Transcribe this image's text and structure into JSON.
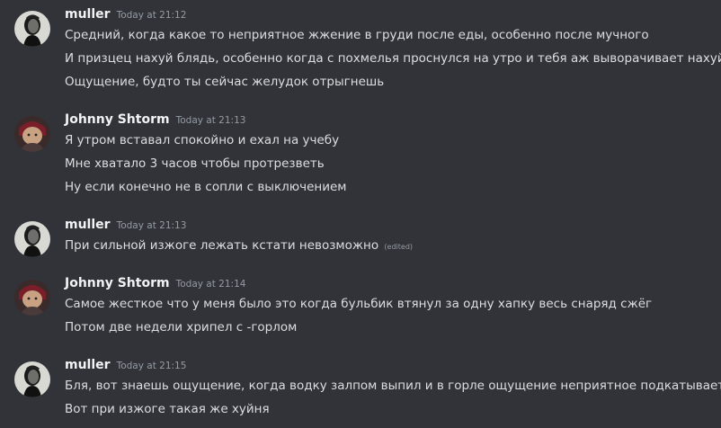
{
  "colors": {
    "background": "#313338",
    "username": "#f2f3f5",
    "message_text": "#dbdee1",
    "timestamp": "#949ba4"
  },
  "messages": [
    {
      "author": "muller",
      "timestamp": "Today at 21:12",
      "avatar_icon": "statue-avatar",
      "lines": [
        "Средний, когда какое то неприятное жжение в груди после еды, особенно после мучного",
        "И призцец нахуй блядь, особенно когда с похмелья проснулся на утро и тебя аж выворачивает нахуй",
        "Ощущение, будто ты сейчас желудок отрыгнешь"
      ]
    },
    {
      "author": "Johnny Shtorm",
      "timestamp": "Today at 21:13",
      "avatar_icon": "cartoon-character-avatar",
      "lines": [
        "Я утром вставал спокойно и ехал на учебу",
        "Мне хватало 3 часов чтобы протрезветь",
        "Ну если конечно не в сопли с выключением"
      ]
    },
    {
      "author": "muller",
      "timestamp": "Today at 21:13",
      "avatar_icon": "statue-avatar",
      "lines": [
        "При сильной изжоге лежать кстати невозможно"
      ],
      "edited_label": "(edited)"
    },
    {
      "author": "Johnny Shtorm",
      "timestamp": "Today at 21:14",
      "avatar_icon": "cartoon-character-avatar",
      "lines": [
        "Самое жесткое что у меня было это когда бульбик втянул за одну хапку весь снаряд сжёг",
        "Потом две недели хрипел с -горлом"
      ]
    },
    {
      "author": "muller",
      "timestamp": "Today at 21:15",
      "avatar_icon": "statue-avatar",
      "lines": [
        "Бля, вот знаешь ощущение, когда водку залпом выпил и в горле ощущение неприятное подкатывает",
        "Вот при изжоге такая же хуйня"
      ]
    }
  ]
}
